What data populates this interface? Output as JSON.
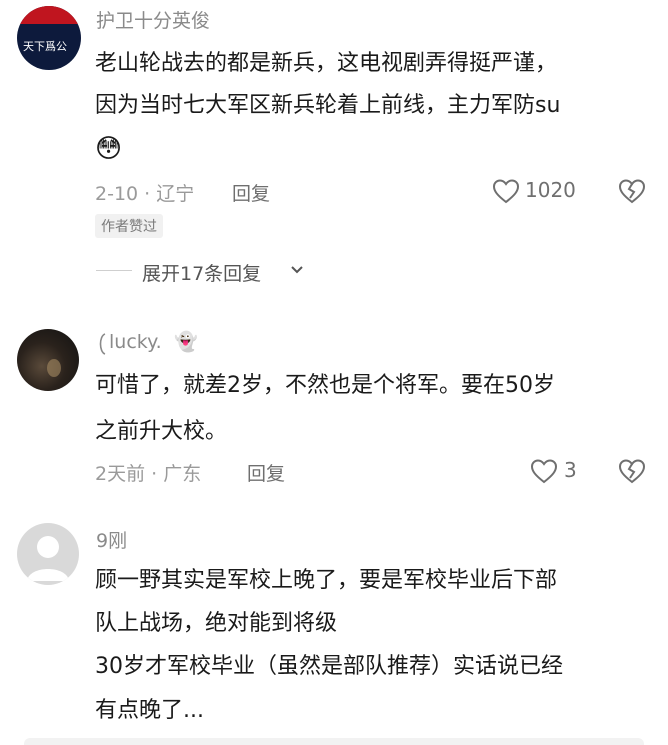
{
  "comments": [
    {
      "avatar_text": "天下爲公",
      "username": "护卫十分英俊",
      "lines": [
        "老山轮战去的都是新兵，这电视剧弄得挺严谨，",
        "因为当时七大军区新兵轮着上前线，主力军防su"
      ],
      "emoji": "😳",
      "date_location": "2-10 · 辽宁",
      "reply_label": "回复",
      "likes": "1020",
      "badge": "作者赞过",
      "expand_label": "展开17条回复"
    },
    {
      "username": "lucky.",
      "username_emoji": "👻",
      "lines": [
        "可惜了，就差2岁，不然也是个将军。要在50岁",
        "之前升大校。"
      ],
      "date_location": "2天前 · 广东",
      "reply_label": "回复",
      "likes": "3"
    },
    {
      "username": "9刚",
      "lines": [
        "顾一野其实是军校上晚了，要是军校毕业后下部",
        "队上战场，绝对能到将级",
        "30岁才军校毕业（虽然是部队推荐）实话说已经",
        "有点晚了..."
      ]
    }
  ],
  "colors": {
    "text": "#1a1a1a",
    "meta": "#9a9a9a",
    "avatar_dark": "#0d1a3c",
    "avatar_red": "#c0151f"
  },
  "icons": [
    "heart-outline-icon",
    "broken-heart-icon",
    "chevron-down-icon",
    "default-avatar-icon"
  ]
}
